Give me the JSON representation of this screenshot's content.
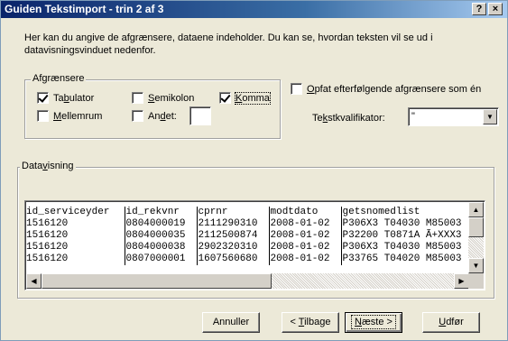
{
  "window": {
    "title": "Guiden Tekstimport - trin 2 af 3",
    "help_label": "?",
    "close_label": "×"
  },
  "intro_text": "Her kan du angive de afgrænsere, dataene indeholder. Du kan se, hvordan teksten vil se ud i datavisningsvinduet nedenfor.",
  "delimiters": {
    "group_label": "Afgrænsere",
    "tab": {
      "label_pre": "Ta",
      "label_u": "b",
      "label_post": "ulator",
      "checked": true
    },
    "semicolon": {
      "label_pre": "",
      "label_u": "S",
      "label_post": "emikolon",
      "checked": false
    },
    "comma": {
      "label_pre": "",
      "label_u": "K",
      "label_post": "omma",
      "checked": true
    },
    "space": {
      "label_pre": "",
      "label_u": "M",
      "label_post": "ellemrum",
      "checked": false
    },
    "other": {
      "label_pre": "An",
      "label_u": "d",
      "label_post": "et:",
      "checked": false,
      "value": ""
    }
  },
  "consecutive": {
    "label_pre": "",
    "label_u": "O",
    "label_post": "pfat efterfølgende afgrænsere som én",
    "checked": false
  },
  "text_qualifier": {
    "label_pre": "Te",
    "label_u": "k",
    "label_post": "stkvalifikator:",
    "value": "\""
  },
  "preview": {
    "group_label_pre": "Data",
    "group_label_u": "v",
    "group_label_post": "isning",
    "columns": [
      "id_serviceyder",
      "id_rekvnr",
      "cprnr",
      "modtdato",
      "getsnomedlist"
    ],
    "rows": [
      [
        "1516120",
        "0804000019",
        "2111290310",
        "2008-01-02",
        "P306X3 T04030 M85003"
      ],
      [
        "1516120",
        "0804000035",
        "2112500874",
        "2008-01-02",
        "P32200 T0871A Ã+XXX3"
      ],
      [
        "1516120",
        "0804000038",
        "2902320310",
        "2008-01-02",
        "P306X3 T04030 M85003"
      ],
      [
        "1516120",
        "0807000001",
        "1607560680",
        "2008-01-02",
        "P33765 T04020 M85003"
      ]
    ]
  },
  "buttons": {
    "cancel": "Annuller",
    "back_pre": "< ",
    "back_u": "T",
    "back_post": "ilbage",
    "next_pre": "",
    "next_u": "N",
    "next_post": "æste >",
    "finish_pre": "",
    "finish_u": "U",
    "finish_post": "dfør"
  }
}
